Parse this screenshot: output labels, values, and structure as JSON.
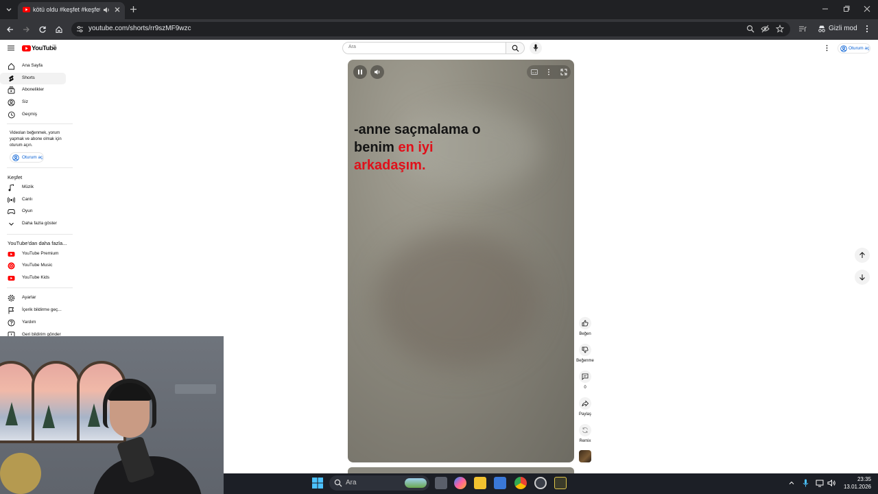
{
  "browser": {
    "tab_title": "kötü oldu #keşfet #keşfet #",
    "url": "youtube.com/shorts/rr9szMF9wzc",
    "incognito_label": "Gizli mod"
  },
  "header": {
    "logo_text": "YouTube",
    "logo_region": "TR",
    "search_placeholder": "Ara",
    "signin_label": "Oturum aç"
  },
  "sidebar": {
    "main_items": [
      {
        "label": "Ana Sayfa",
        "icon": "home-icon"
      },
      {
        "label": "Shorts",
        "icon": "shorts-icon",
        "active": true
      },
      {
        "label": "Abonelikler",
        "icon": "subscriptions-icon"
      },
      {
        "label": "Siz",
        "icon": "you-icon"
      },
      {
        "label": "Geçmiş",
        "icon": "history-icon"
      }
    ],
    "signin_note": "Videoları beğenmek, yorum yapmak ve abone olmak için oturum açın.",
    "signin_label": "Oturum aç",
    "explore_heading": "Keşfet",
    "explore_items": [
      {
        "label": "Müzik",
        "icon": "music-icon"
      },
      {
        "label": "Canlı",
        "icon": "live-icon"
      },
      {
        "label": "Oyun",
        "icon": "gaming-icon"
      },
      {
        "label": "Daha fazla göster",
        "icon": "chevron-down-icon"
      }
    ],
    "more_heading": "YouTube'dan daha fazla...",
    "more_items": [
      {
        "label": "YouTube Premium",
        "icon": "youtube-premium-icon"
      },
      {
        "label": "YouTube Music",
        "icon": "youtube-music-icon"
      },
      {
        "label": "YouTube Kids",
        "icon": "youtube-kids-icon"
      }
    ],
    "settings_items": [
      {
        "label": "Ayarlar",
        "icon": "settings-icon"
      },
      {
        "label": "İçerik bildirme geç...",
        "icon": "flag-icon"
      },
      {
        "label": "Yardım",
        "icon": "help-icon"
      },
      {
        "label": "Geri bildirim gönder",
        "icon": "feedback-icon"
      }
    ]
  },
  "video": {
    "caption_line1": "-anne saçmalama o",
    "caption_line2_black": "benim",
    "caption_line2_red": "en iyi",
    "caption_line3_red": "arkadaşım.",
    "playing": true
  },
  "actions": {
    "like_label": "Beğen",
    "dislike_label": "Beğenme",
    "comments_count": "0",
    "share_label": "Paylaş",
    "remix_label": "Remix"
  },
  "taskbar": {
    "search_placeholder": "Ara",
    "time": "23:35",
    "date": "13.01.2026"
  },
  "colors": {
    "youtube_red": "#ff0000",
    "caption_red": "#e0101a",
    "link_blue": "#065fd4",
    "chrome_dark": "#202124"
  }
}
